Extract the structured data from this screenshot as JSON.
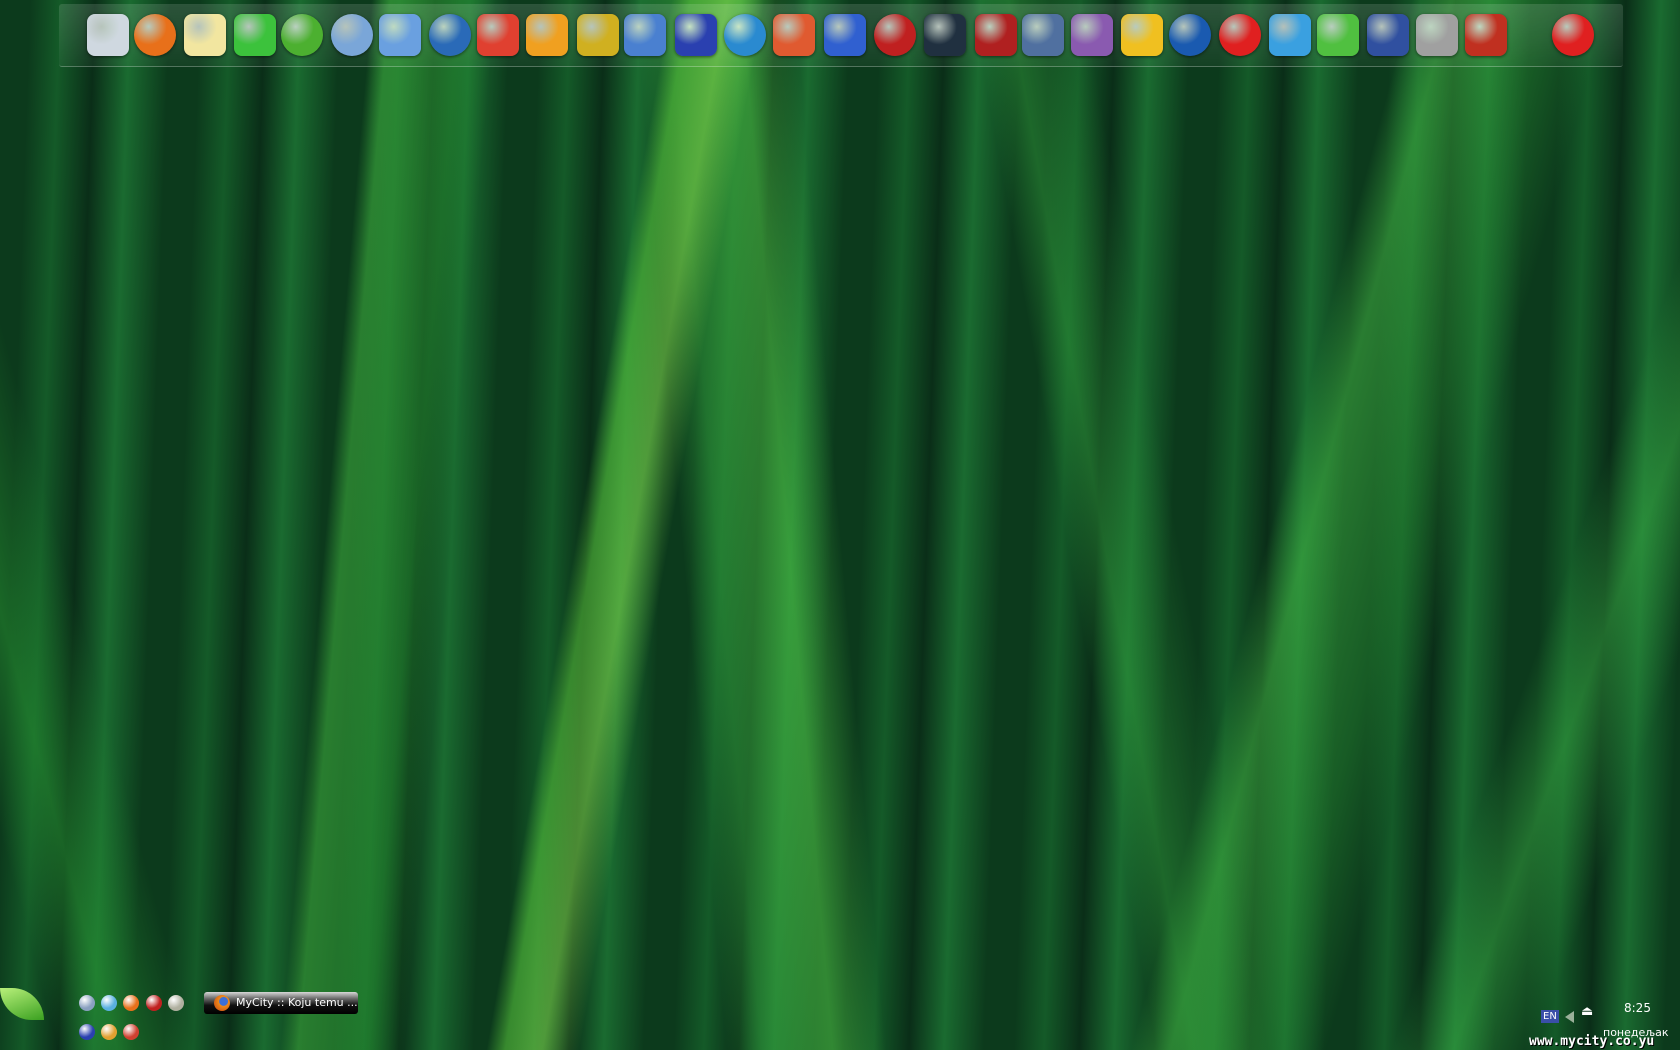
{
  "dock": {
    "icons": [
      {
        "name": "my-computer-icon",
        "color": "#cfd8e0"
      },
      {
        "name": "firefox-icon",
        "color": "#e8701a"
      },
      {
        "name": "notepad-icon",
        "color": "#f2e6a0"
      },
      {
        "name": "icq-icon",
        "color": "#3cc23c"
      },
      {
        "name": "utorrent-icon",
        "color": "#4cb030"
      },
      {
        "name": "safari-icon",
        "color": "#7aa6d8"
      },
      {
        "name": "messenger-icon",
        "color": "#6aa0e0"
      },
      {
        "name": "media-player-icon",
        "color": "#2a6ab8"
      },
      {
        "name": "chart-app-icon",
        "color": "#e04030"
      },
      {
        "name": "winamp-icon",
        "color": "#f0a020"
      },
      {
        "name": "video-editor-icon",
        "color": "#d0b020"
      },
      {
        "name": "paint-icon",
        "color": "#4a80d0"
      },
      {
        "name": "floppy-save-icon",
        "color": "#2a40b0"
      },
      {
        "name": "globe-icon",
        "color": "#2a8ad0"
      },
      {
        "name": "cube-app-icon",
        "color": "#e05a30"
      },
      {
        "name": "blocks-icon",
        "color": "#3060d0"
      },
      {
        "name": "nero-icon",
        "color": "#c02020"
      },
      {
        "name": "clock-icon",
        "color": "#203040"
      },
      {
        "name": "close-x-icon",
        "color": "#b02020"
      },
      {
        "name": "window-app-icon",
        "color": "#5070a0"
      },
      {
        "name": "winrar-icon",
        "color": "#8a5ab0"
      },
      {
        "name": "tools-icon",
        "color": "#f0c020"
      },
      {
        "name": "blue-sphere-icon",
        "color": "#1a5ab0"
      },
      {
        "name": "stop-icon",
        "color": "#e02020"
      },
      {
        "name": "wii-icon",
        "color": "#3aa0e0"
      },
      {
        "name": "skype-figure-icon",
        "color": "#50c040"
      },
      {
        "name": "window-manager-icon",
        "color": "#3050a0"
      },
      {
        "name": "disk-drive-icon",
        "color": "#a0a0a0"
      },
      {
        "name": "wifi-antenna-icon",
        "color": "#c03020"
      },
      {
        "name": "stop-icon",
        "color": "#e02020"
      }
    ]
  },
  "taskbar": {
    "quicklaunch": [
      {
        "name": "safari-icon",
        "color": "#8aa0c0"
      },
      {
        "name": "network-icon",
        "color": "#5ab0e0"
      },
      {
        "name": "firefox-icon",
        "color": "#e8701a"
      },
      {
        "name": "nero-icon",
        "color": "#c02020"
      },
      {
        "name": "desktop-icon",
        "color": "#b0b0a0"
      },
      {
        "name": "floppy-save-icon",
        "color": "#2a40b0"
      },
      {
        "name": "winamp-icon",
        "color": "#e0a030"
      },
      {
        "name": "chrome-like-icon",
        "color": "#d04030"
      }
    ],
    "task_label": "MyCity :: Koju temu ...",
    "language": "EN",
    "time": "8:25",
    "day": "понедељак"
  },
  "watermark": "www.mycity.co.yu"
}
